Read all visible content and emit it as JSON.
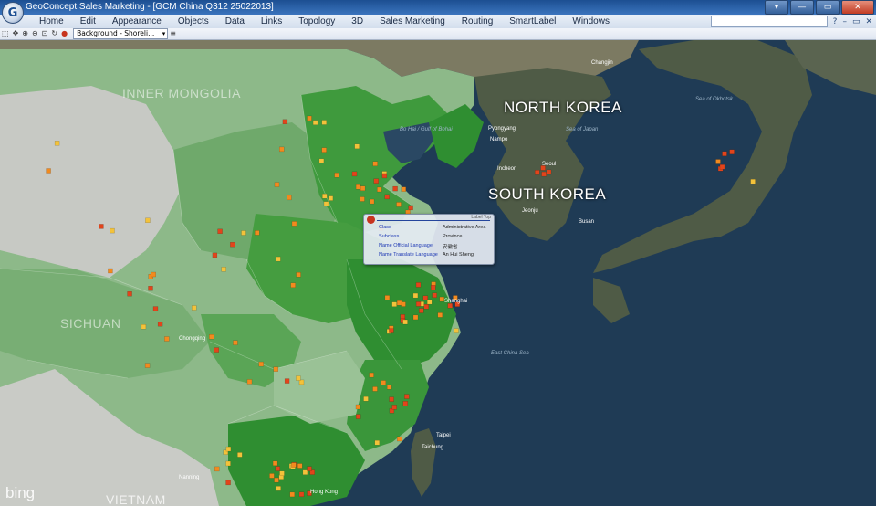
{
  "window": {
    "title": "GeoConcept Sales Marketing - [GCM China Q312 25022013]",
    "app_icon_letter": "G",
    "controls": [
      "▾",
      "—",
      "▭",
      "✕"
    ]
  },
  "menu": {
    "items": [
      "Home",
      "Edit",
      "Appearance",
      "Objects",
      "Data",
      "Links",
      "Topology",
      "3D",
      "Sales Marketing",
      "Routing",
      "SmartLabel",
      "Windows"
    ],
    "search_placeholder": "",
    "help_icon": "?",
    "mdi_controls": [
      "–",
      "▭",
      "✕"
    ]
  },
  "toolbar": {
    "layer_selected": "Background - Shoreli...",
    "extra": "≡"
  },
  "map": {
    "countries": {
      "north_korea": "NORTH KOREA",
      "south_korea": "SOUTH KOREA",
      "vietnam": "VIETNAM"
    },
    "regions": {
      "inner_mongolia": "INNER MONGOLIA",
      "sichuan": "SICHUAN"
    },
    "seas": {
      "bohai": "Bo Hai / Gulf of Bohai",
      "japan": "Sea of Japan",
      "east_china": "East China Sea",
      "okhotsk": "Sea of Okhotsk"
    },
    "cities": [
      "Changjin",
      "Pyongyang",
      "Nampo",
      "Incheon",
      "Seoul",
      "Jeonju",
      "Busan",
      "Chongqing",
      "Shanghai",
      "Taichung",
      "Taipei",
      "Hong Kong",
      "Nanning"
    ],
    "watermark": "bing"
  },
  "tooltip": {
    "header_button": "Label Top",
    "rows": [
      {
        "key": "Class",
        "value": "Administrative Area"
      },
      {
        "key": "Subclass",
        "value": "Province"
      },
      {
        "key": "Name Official Language",
        "value": "安徽省"
      },
      {
        "key": "Name Translate Language",
        "value": "An Hui Sheng"
      }
    ]
  },
  "colors": {
    "accent": "#1c4f92",
    "marker_red": "#e2441b",
    "marker_orange": "#f28a1e",
    "marker_yellow": "#f3c23a",
    "province_green": "#3d9a3b"
  }
}
